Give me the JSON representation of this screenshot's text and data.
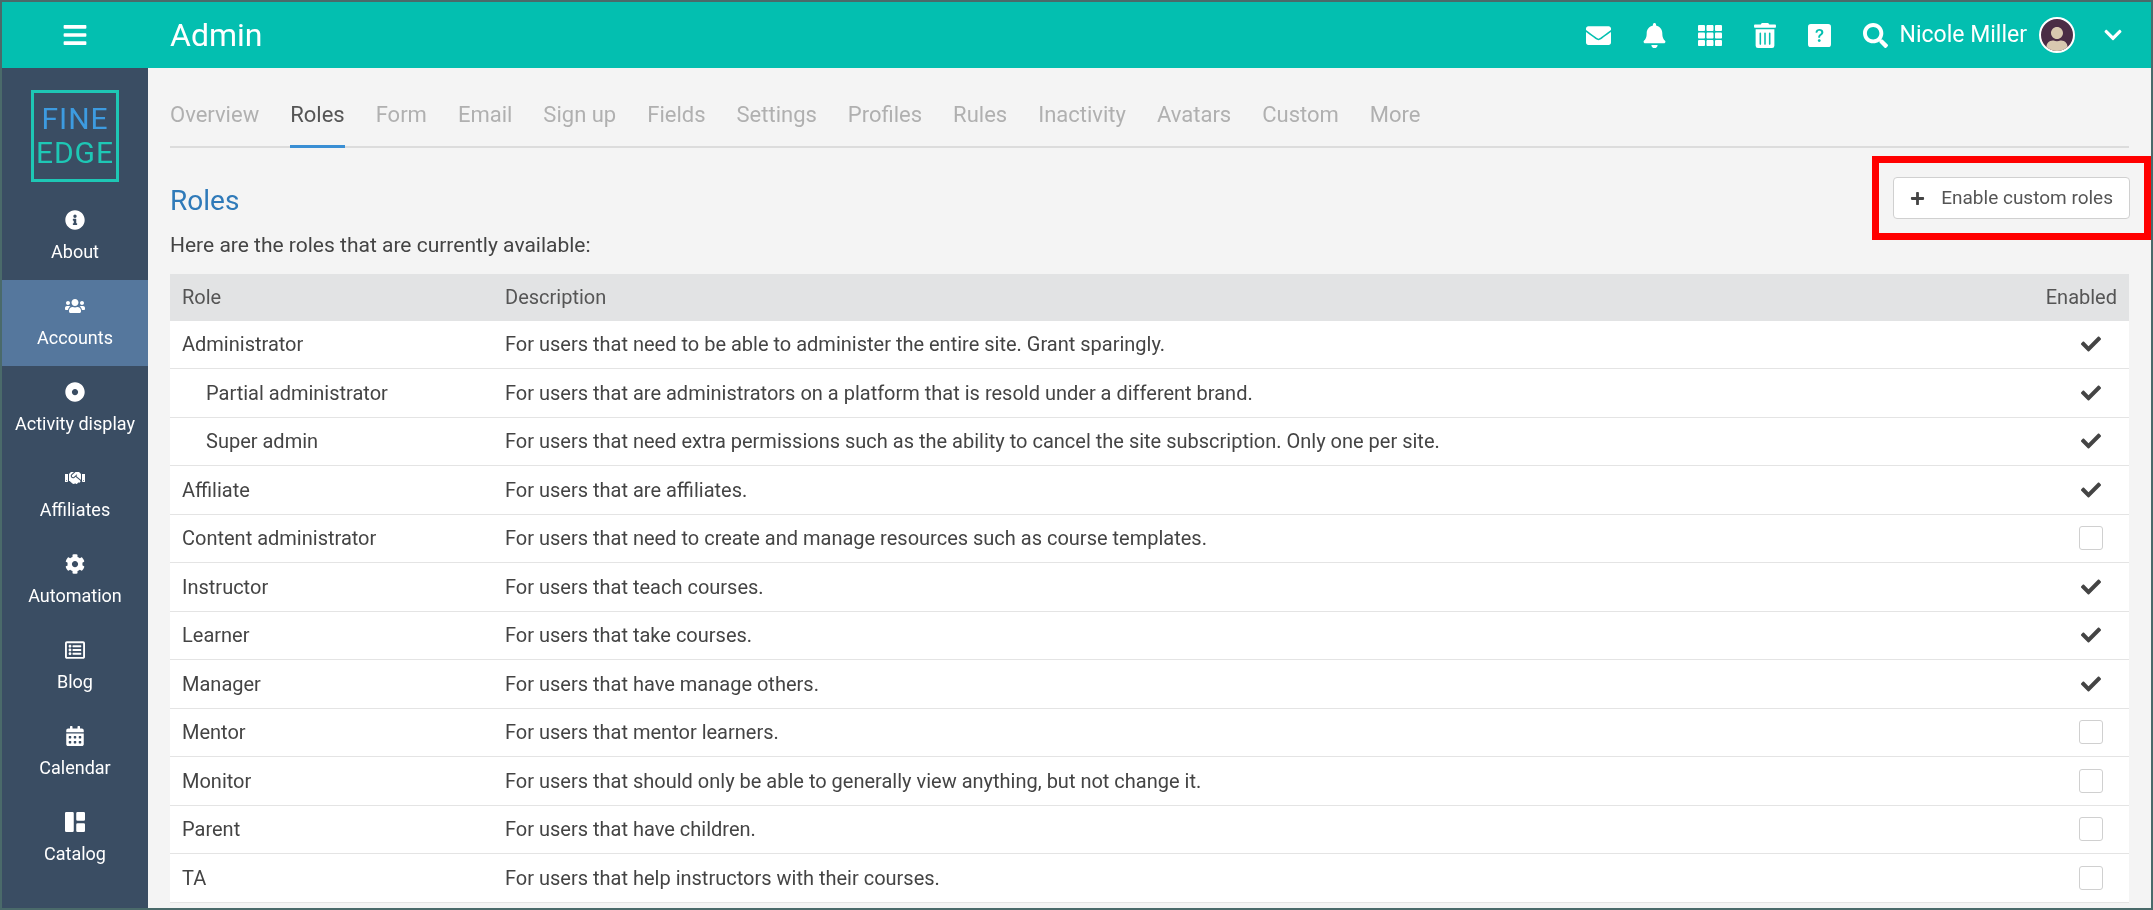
{
  "header": {
    "title": "Admin",
    "user": "Nicole Miller"
  },
  "logo": {
    "line_1": "FINE",
    "line_2": "EDGE"
  },
  "sidebar": {
    "items": [
      {
        "label": "About",
        "selected": false
      },
      {
        "label": "Accounts",
        "selected": true
      },
      {
        "label": "Activity display",
        "selected": false
      },
      {
        "label": "Affiliates",
        "selected": false
      },
      {
        "label": "Automation",
        "selected": false
      },
      {
        "label": "Blog",
        "selected": false
      },
      {
        "label": "Calendar",
        "selected": false
      },
      {
        "label": "Catalog",
        "selected": false
      }
    ]
  },
  "tabs": [
    {
      "label": "Overview",
      "selected": false
    },
    {
      "label": "Roles",
      "selected": true
    },
    {
      "label": "Form",
      "selected": false
    },
    {
      "label": "Email",
      "selected": false
    },
    {
      "label": "Sign up",
      "selected": false
    },
    {
      "label": "Fields",
      "selected": false
    },
    {
      "label": "Settings",
      "selected": false
    },
    {
      "label": "Profiles",
      "selected": false
    },
    {
      "label": "Rules",
      "selected": false
    },
    {
      "label": "Inactivity",
      "selected": false
    },
    {
      "label": "Avatars",
      "selected": false
    },
    {
      "label": "Custom",
      "selected": false
    },
    {
      "label": "More",
      "selected": false
    }
  ],
  "section": {
    "title": "Roles",
    "button": "Enable custom roles",
    "intro": "Here are the roles that are currently available:"
  },
  "table": {
    "columns": [
      "Role",
      "Description",
      "Enabled"
    ],
    "rows": [
      {
        "role": "Administrator",
        "description": "For users that need to be able to administer the entire site. Grant sparingly.",
        "enabled": true,
        "children": [
          {
            "role": "Partial administrator",
            "description": "For users that are administrators on a platform that is resold under a different brand.",
            "enabled": true
          },
          {
            "role": "Super admin",
            "description": "For users that need extra permissions such as the ability to cancel the site subscription. Only one per site.",
            "enabled": true
          }
        ]
      },
      {
        "role": "Affiliate",
        "description": "For users that are affiliates.",
        "enabled": true
      },
      {
        "role": "Content administrator",
        "description": "For users that need to create and manage resources such as course templates.",
        "enabled": false
      },
      {
        "role": "Instructor",
        "description": "For users that teach courses.",
        "enabled": true
      },
      {
        "role": "Learner",
        "description": "For users that take courses.",
        "enabled": true
      },
      {
        "role": "Manager",
        "description": "For users that have manage others.",
        "enabled": true
      },
      {
        "role": "Mentor",
        "description": "For users that mentor learners.",
        "enabled": false
      },
      {
        "role": "Monitor",
        "description": "For users that should only be able to generally view anything, but not change it.",
        "enabled": false
      },
      {
        "role": "Parent",
        "description": "For users that have children.",
        "enabled": false
      },
      {
        "role": "TA",
        "description": "For users that help instructors with their courses.",
        "enabled": false
      }
    ]
  }
}
